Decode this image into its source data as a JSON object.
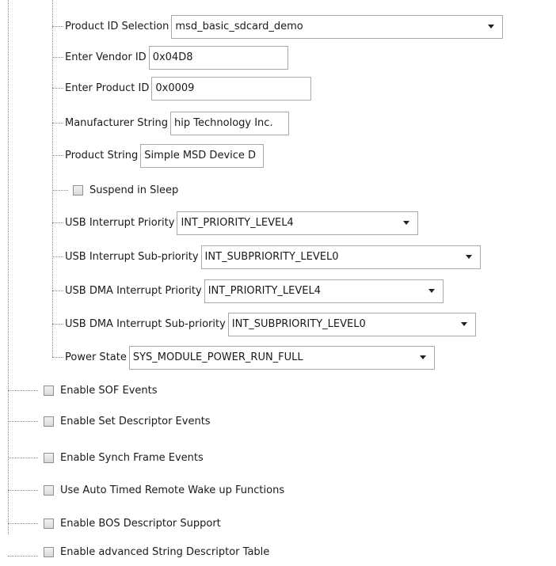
{
  "tree": {
    "nested_items": [
      {
        "label": "Product ID Selection",
        "type": "combo",
        "value": "msd_basic_sdcard_demo"
      },
      {
        "label": "Enter Vendor ID",
        "type": "text",
        "value": "0x04D8"
      },
      {
        "label": "Enter Product ID",
        "type": "text",
        "value": "0x0009"
      },
      {
        "label": "Manufacturer String",
        "type": "text",
        "value": "hip Technology Inc."
      },
      {
        "label": "Product String",
        "type": "text",
        "value": "Simple MSD Device D"
      },
      {
        "label": "Suspend in Sleep",
        "type": "checkbox",
        "checked": false
      },
      {
        "label": "USB Interrupt Priority",
        "type": "combo",
        "value": "INT_PRIORITY_LEVEL4"
      },
      {
        "label": "USB Interrupt Sub-priority",
        "type": "combo",
        "value": "INT_SUBPRIORITY_LEVEL0"
      },
      {
        "label": "USB DMA Interrupt Priority",
        "type": "combo",
        "value": "INT_PRIORITY_LEVEL4"
      },
      {
        "label": "USB DMA Interrupt Sub-priority",
        "type": "combo",
        "value": "INT_SUBPRIORITY_LEVEL0"
      },
      {
        "label": "Power State",
        "type": "combo",
        "value": "SYS_MODULE_POWER_RUN_FULL"
      }
    ],
    "root_items": [
      {
        "label": "Enable SOF Events",
        "checked": false
      },
      {
        "label": "Enable Set Descriptor Events",
        "checked": false
      },
      {
        "label": "Enable Synch Frame Events",
        "checked": false
      },
      {
        "label": "Use Auto Timed Remote Wake up Functions",
        "checked": false
      },
      {
        "label": "Enable BOS Descriptor Support",
        "checked": false
      },
      {
        "label": "Enable advanced String Descriptor Table",
        "checked": false
      }
    ]
  }
}
